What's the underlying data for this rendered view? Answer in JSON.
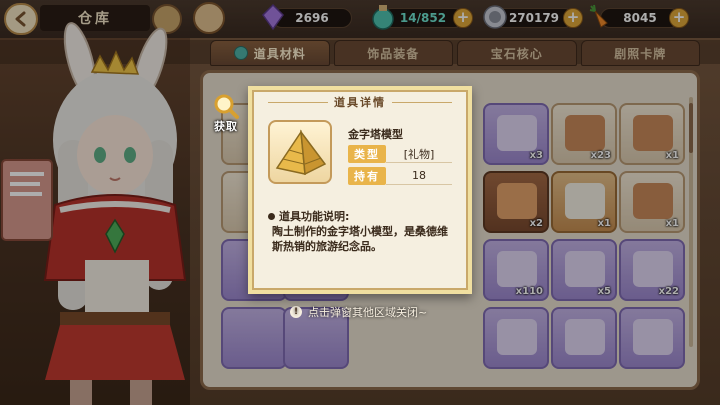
{
  "header": {
    "title": "仓库",
    "resources": {
      "crystal": "2696",
      "potion": "14/852",
      "coin": "270179",
      "carrot": "8045"
    }
  },
  "tabs": [
    {
      "label": "道具材料",
      "active": true
    },
    {
      "label": "饰品装备",
      "active": false
    },
    {
      "label": "宝石核心",
      "active": false
    },
    {
      "label": "剧照卡牌",
      "active": false
    }
  ],
  "acquire": {
    "label": "获取"
  },
  "inventory": {
    "slots": [
      {
        "style": "purple",
        "qty": "x3"
      },
      {
        "style": "plain",
        "qty": "x23"
      },
      {
        "style": "plain",
        "qty": "x1"
      },
      {
        "style": "brown",
        "qty": "x2"
      },
      {
        "style": "orange",
        "qty": "x1"
      },
      {
        "style": "plain",
        "qty": "x1"
      },
      {
        "style": "purple",
        "qty": "x110"
      },
      {
        "style": "purple",
        "qty": "x5"
      },
      {
        "style": "purple",
        "qty": "x22"
      },
      {
        "style": "purple",
        "qty": ""
      },
      {
        "style": "purple",
        "qty": ""
      },
      {
        "style": "purple",
        "qty": ""
      }
    ]
  },
  "popup": {
    "title": "道具详情",
    "item_name": "金字塔模型",
    "type_label": "类型",
    "type_value": "[礼物]",
    "own_label": "持有",
    "own_value": "18",
    "desc_title": "道具功能说明:",
    "desc_text": "陶土制作的金字塔小模型，是桑德维斯热销的旅游纪念品。"
  },
  "hint": {
    "text": "点击弹窗其他区域关闭~"
  },
  "colors": {
    "accent": "#e9b44a",
    "panel": "#f5efe0",
    "frame": "#f0dfa0"
  }
}
